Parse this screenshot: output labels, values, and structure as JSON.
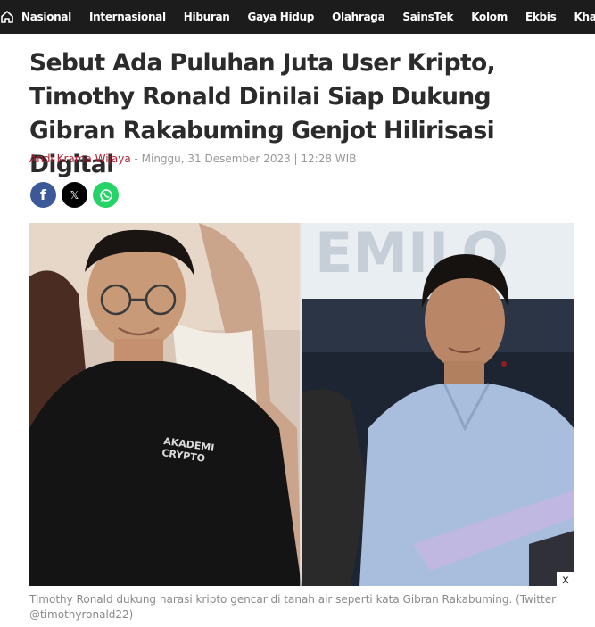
{
  "nav": {
    "home_icon": "home-icon",
    "items": [
      "Nasional",
      "Internasional",
      "Hiburan",
      "Gaya Hidup",
      "Olahraga",
      "SainsTek",
      "Kolom",
      "Ekbis",
      "Khaza"
    ]
  },
  "article": {
    "title": "Sebut Ada Puluhan Juta User Kripto, Timothy Ronald Dinilai Siap Dukung Gibran Rakabuming Genjot Hilirisasi Digital",
    "author": "Andi Krama Wijaya",
    "separator": " - ",
    "date": "Minggu, 31 Desember 2023 | 12:28 WIB"
  },
  "share": {
    "facebook_label": "f",
    "x_label": "𝕏",
    "whatsapp_icon": "whatsapp-icon"
  },
  "photo": {
    "shirt_text_line1": "AKADEMI",
    "shirt_text_line2": "CRYPTO",
    "backdrop_text": "EMILO"
  },
  "close_label": "x",
  "caption": "Timothy Ronald dukung narasi kripto gencar di tanah air seperti kata Gibran Rakabuming. (Twitter @timothyronald22)"
}
